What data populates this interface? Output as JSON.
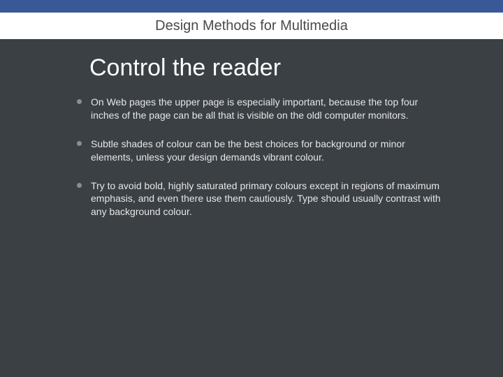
{
  "header": {
    "title": "Design Methods for Multimedia"
  },
  "slide": {
    "title": "Control the reader",
    "bullets": [
      "On Web pages the upper page is especially important, because the top four inches of the page can be  all that is visible on the oldl computer monitors.",
      "Subtle shades of colour can be the best choices for background or minor elements, unless your design demands vibrant colour.",
      "Try to avoid bold, highly saturated primary colours except in regions of maximum emphasis, and even there use them cautiously. Type should usually contrast with any background colour."
    ]
  }
}
